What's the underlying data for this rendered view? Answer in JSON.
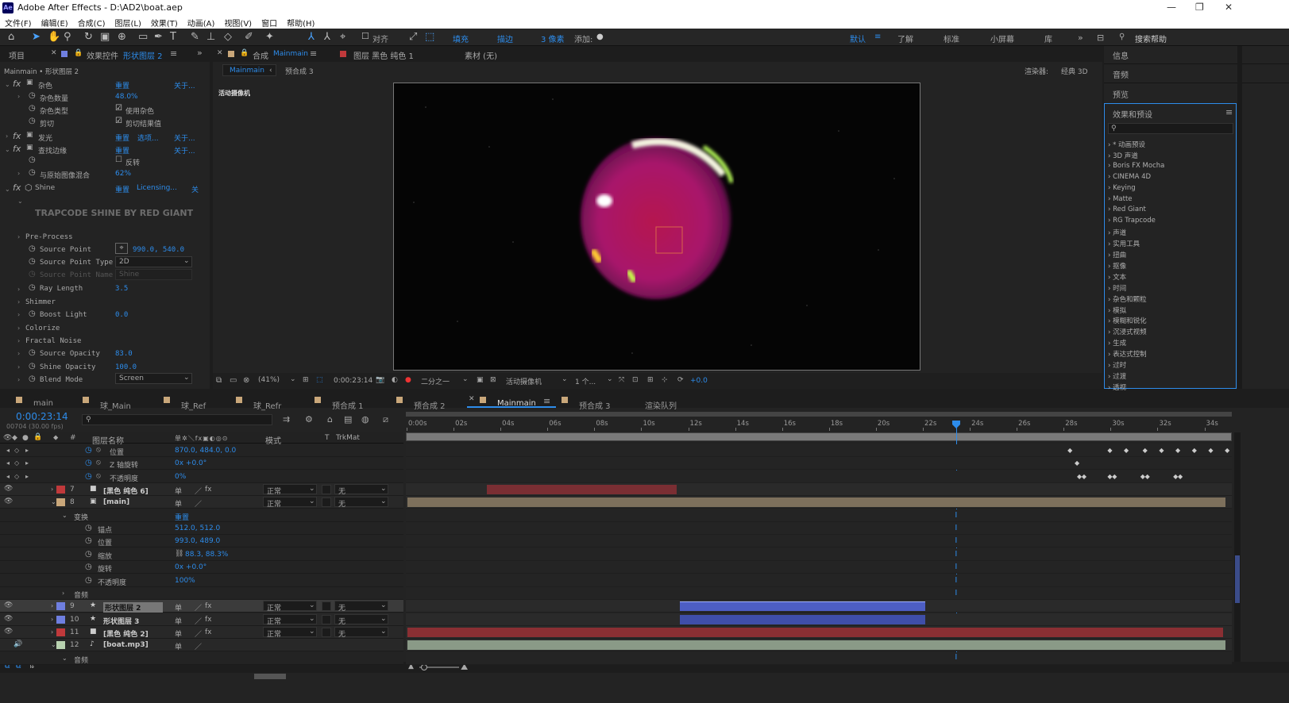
{
  "window": {
    "title": "Adobe After Effects - D:\\AD2\\boat.aep",
    "logo": "Ae"
  },
  "menu": [
    "文件(F)",
    "编辑(E)",
    "合成(C)",
    "图层(L)",
    "效果(T)",
    "动画(A)",
    "视图(V)",
    "窗口",
    "帮助(H)"
  ],
  "toolbar": {
    "align": "对齐",
    "fill": "填充",
    "fill_value": "?",
    "stroke": "描边",
    "stroke_px": "3 像素",
    "add": "添加:",
    "workspaces": [
      "默认",
      "了解",
      "标准",
      "小屏幕",
      "库"
    ],
    "search_help": "搜索帮助"
  },
  "left_panel": {
    "tabs": [
      "项目",
      "效果控件",
      "形状图层 2"
    ],
    "breadcrumb": "Mainmain • 形状图层 2",
    "effects": [
      {
        "name": "杂色",
        "reset": "重置",
        "about": "关于..."
      },
      {
        "name": "发光",
        "reset": "重置",
        "options": "选项...",
        "about": "关于..."
      },
      {
        "name": "查找边缘",
        "reset": "重置",
        "about": "关于..."
      },
      {
        "name": "Shine",
        "reset": "重置",
        "licensing": "Licensing...",
        "about": "关"
      }
    ],
    "noise": {
      "amount_label": "杂色数量",
      "amount_value": "48.0%",
      "type_label": "杂色类型",
      "type_value": "使用杂色",
      "clip_label": "剪切",
      "clip_value": "剪切结果值"
    },
    "find_edges": {
      "invert": "反转",
      "blend_label": "与原始图像混合",
      "blend_value": "62%"
    },
    "shine": {
      "banner": "TRAPCODE SHINE BY RED GIANT",
      "pre_process": "Pre-Process",
      "source_point_label": "Source Point",
      "source_point_value": "990.0, 540.0",
      "source_point_type_label": "Source Point Type",
      "source_point_type_value": "2D",
      "source_point_name_label": "Source Point Name",
      "source_point_name_value": "Shine",
      "ray_length_label": "Ray Length",
      "ray_length_value": "3.5",
      "shimmer": "Shimmer",
      "boost_light_label": "Boost Light",
      "boost_light_value": "0.0",
      "colorize": "Colorize",
      "fractal_noise": "Fractal Noise",
      "source_opacity_label": "Source Opacity",
      "source_opacity_value": "83.0",
      "shine_opacity_label": "Shine Opacity",
      "shine_opacity_value": "100.0",
      "blend_mode_label": "Blend Mode",
      "blend_mode_value": "Screen"
    }
  },
  "viewer": {
    "tabs": [
      "合成",
      "Mainmain",
      "图层 黑色 纯色 1",
      "素材 (无)"
    ],
    "subtabs": [
      "Mainmain",
      "预合成 3"
    ],
    "renderer_label": "渲染器:",
    "renderer_value": "经典 3D",
    "camera_label": "活动摄像机",
    "zoom": "(41%)",
    "timecode": "0:00:23:14",
    "resolution": "二分之一",
    "camera_select": "活动摄像机",
    "views": "1 个...",
    "exposure": "+0.0"
  },
  "right_panel": {
    "items": [
      "信息",
      "音频",
      "预览"
    ],
    "effects_title": "效果和预设",
    "search_placeholder": "",
    "categories": [
      "* 动画预设",
      "3D 声道",
      "Boris FX Mocha",
      "CINEMA 4D",
      "Keying",
      "Matte",
      "Red Giant",
      "RG Trapcode",
      "声道",
      "实用工具",
      "扭曲",
      "抠像",
      "文本",
      "时间",
      "杂色和颗粒",
      "模拟",
      "模糊和锐化",
      "沉浸式视频",
      "生成",
      "表达式控制",
      "过时",
      "过渡",
      "透视"
    ]
  },
  "timeline": {
    "tabs": [
      "main",
      "球_Main",
      "球_Ref",
      "球_Refr",
      "预合成 1",
      "预合成 2",
      "Mainmain",
      "预合成 3",
      "渲染队列"
    ],
    "tab_colors": [
      "#c9a77a",
      "#c9a77a",
      "#c9a77a",
      "#c9a77a",
      "#c9a77a",
      "#c9a77a",
      "#c9a77a",
      "#c9a77a",
      "#888888"
    ],
    "timecode": "0:00:23:14",
    "frames": "00704 (30.00 fps)",
    "col_headers": {
      "num": "#",
      "name": "图层名称",
      "mode": "模式",
      "t": "T",
      "trkmat": "TrkMat"
    },
    "ruler": [
      "0:00s",
      "02s",
      "04s",
      "06s",
      "08s",
      "10s",
      "12s",
      "14s",
      "16s",
      "18s",
      "20s",
      "22s",
      "24s",
      "26s",
      "28s",
      "30s",
      "32s",
      "34s"
    ],
    "playhead_seconds": 23.47,
    "duration_seconds": 35,
    "props_top": [
      {
        "name": "位置",
        "value": "870.0, 484.0, 0.0"
      },
      {
        "name": "Z 轴旋转",
        "value": "0x +0.0°"
      },
      {
        "name": "不透明度",
        "value": "0%"
      }
    ],
    "layers": [
      {
        "num": "7",
        "name": "[黑色 纯色 6]",
        "color": "#c0393b",
        "mode": "正常",
        "trkmat": "无"
      },
      {
        "num": "8",
        "name": "[main]",
        "color": "#c9a77a",
        "mode": "正常",
        "trkmat": "无"
      },
      {
        "num": "9",
        "name": "形状图层 2",
        "color": "#6f7fe0",
        "mode": "正常",
        "trkmat": "无"
      },
      {
        "num": "10",
        "name": "形状图层 3",
        "color": "#6f7fe0",
        "mode": "正常",
        "trkmat": "无"
      },
      {
        "num": "11",
        "name": "[黑色 纯色 2]",
        "color": "#c0393b",
        "mode": "正常",
        "trkmat": "无"
      },
      {
        "num": "12",
        "name": "[boat.mp3]",
        "color": "#b8d2b0",
        "mode": "",
        "trkmat": ""
      }
    ],
    "transform": {
      "label": "变换",
      "reset": "重置",
      "props": [
        {
          "name": "锚点",
          "value": "512.0, 512.0"
        },
        {
          "name": "位置",
          "value": "993.0, 489.0"
        },
        {
          "name": "缩放",
          "value": "88.3, 88.3%"
        },
        {
          "name": "旋转",
          "value": "0x +0.0°"
        },
        {
          "name": "不透明度",
          "value": "100%"
        }
      ]
    },
    "audio_label": "音频",
    "bars": [
      {
        "layer": "7",
        "start": 3.4,
        "end": 11.6,
        "color": "#7a2e33"
      },
      {
        "layer": "8",
        "start": 0,
        "end": 35,
        "color": "#7d705c"
      },
      {
        "layer": "9",
        "start": 11.6,
        "end": 22.2,
        "color": "#4d5ec4"
      },
      {
        "layer": "10",
        "start": 11.6,
        "end": 22.2,
        "color": "#3f4ea8"
      },
      {
        "layer": "11",
        "start": 0,
        "end": 34.9,
        "color": "#8a2f33"
      },
      {
        "layer": "12",
        "start": 0,
        "end": 35,
        "color": "#8a9a87"
      }
    ]
  }
}
